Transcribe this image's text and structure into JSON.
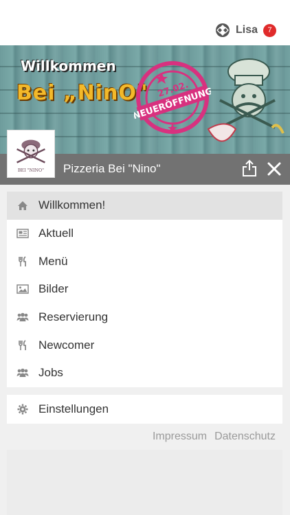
{
  "topbar": {
    "user_name": "Lisa",
    "notification_count": "7",
    "badge_color": "#e02b2b"
  },
  "banner": {
    "line1": "Willkommen",
    "line2": "Bei „NinO\"",
    "stamp_date": "27.02.",
    "stamp_text": "NEUERÖFFNUNG"
  },
  "shop": {
    "name": "Pizzeria Bei \"Nino\"",
    "logo_caption": "BEI \"NINO\""
  },
  "menu": {
    "items": [
      {
        "label": "Willkommen!",
        "icon": "home-icon",
        "active": true
      },
      {
        "label": "Aktuell",
        "icon": "newspaper-icon",
        "active": false
      },
      {
        "label": "Menü",
        "icon": "cutlery-icon",
        "active": false
      },
      {
        "label": "Bilder",
        "icon": "image-icon",
        "active": false
      },
      {
        "label": "Reservierung",
        "icon": "users-icon",
        "active": false
      },
      {
        "label": "Newcomer",
        "icon": "cutlery-icon",
        "active": false
      },
      {
        "label": "Jobs",
        "icon": "users-icon",
        "active": false
      }
    ],
    "settings_label": "Einstellungen",
    "settings_icon": "gear-icon"
  },
  "footer": {
    "impressum": "Impressum",
    "datenschutz": "Datenschutz"
  }
}
